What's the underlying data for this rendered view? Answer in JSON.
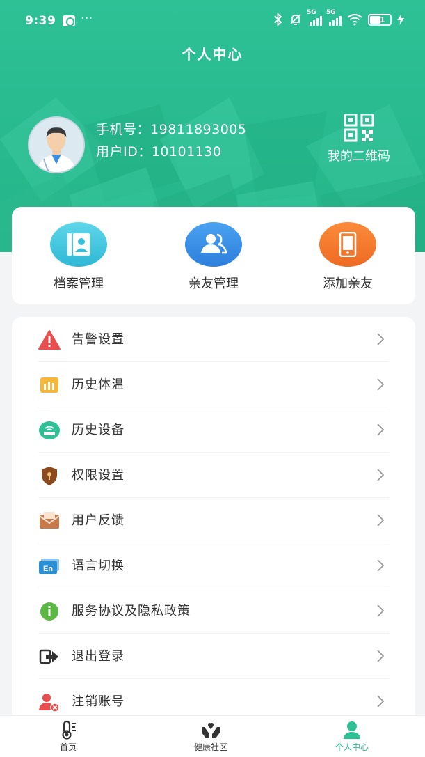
{
  "status_bar": {
    "time": "9:39",
    "dots": "···",
    "network_tag_1": "5G",
    "network_tag_2": "5G",
    "battery": "51"
  },
  "header": {
    "title": "个人中心"
  },
  "profile": {
    "phone_label": "手机号：",
    "phone": "19811893005",
    "user_id_label": "用户ID：",
    "user_id": "10101130",
    "qr_label": "我的二维码"
  },
  "quick_actions": [
    {
      "label": "档案管理",
      "icon": "profile-card-icon",
      "color": "#3cc3df"
    },
    {
      "label": "亲友管理",
      "icon": "friends-icon",
      "color": "#3a8ee6"
    },
    {
      "label": "添加亲友",
      "icon": "phone-icon",
      "color": "#f47a2f"
    }
  ],
  "menu": [
    {
      "label": "告警设置",
      "icon": "warning-icon"
    },
    {
      "label": "历史体温",
      "icon": "chart-icon"
    },
    {
      "label": "历史设备",
      "icon": "router-icon"
    },
    {
      "label": "权限设置",
      "icon": "shield-lock-icon"
    },
    {
      "label": "用户反馈",
      "icon": "mail-icon"
    },
    {
      "label": "语言切换",
      "icon": "language-icon"
    },
    {
      "label": "服务协议及隐私政策",
      "icon": "info-icon"
    },
    {
      "label": "退出登录",
      "icon": "logout-icon"
    },
    {
      "label": "注销账号",
      "icon": "delete-user-icon"
    }
  ],
  "language_icon_text": "En",
  "bottom_nav": [
    {
      "label": "首页",
      "icon": "thermometer-icon"
    },
    {
      "label": "健康社区",
      "icon": "community-icon"
    },
    {
      "label": "个人中心",
      "icon": "person-icon",
      "active": true
    }
  ],
  "colors": {
    "primary": "#2ec196",
    "warning": "#e94e4e",
    "chart": "#f5b83d",
    "router": "#2ec196",
    "shield": "#8b4a1e",
    "mail": "#c9794a",
    "language": "#2a8fd6",
    "info": "#5bb844",
    "logout": "#333333",
    "delete_user": "#e94e4e"
  }
}
